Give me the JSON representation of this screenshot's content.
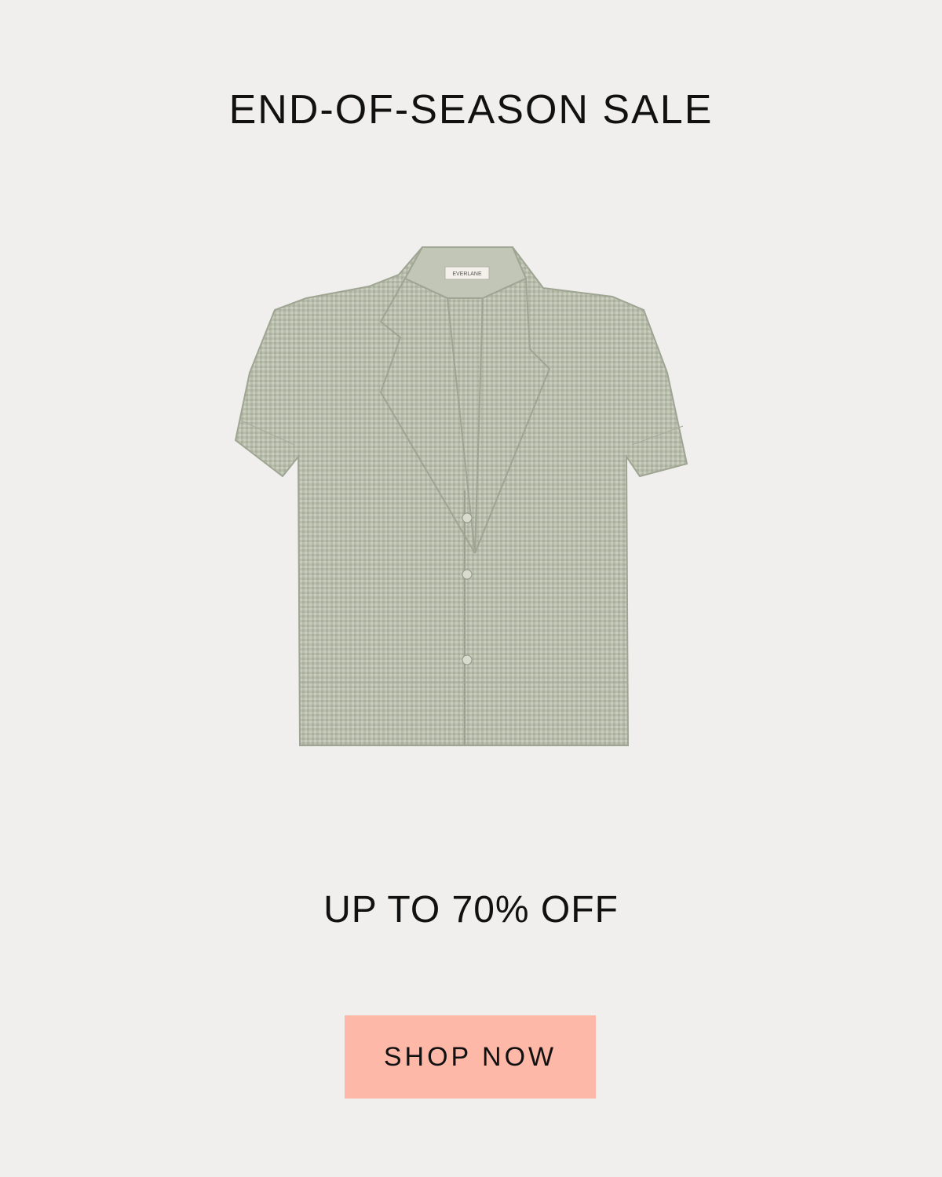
{
  "promo": {
    "headline": "END-OF-SEASON SALE",
    "subheadline": "UP TO 70% OFF",
    "cta_label": "SHOP NOW"
  },
  "product": {
    "label_text": "EVERLANE",
    "color": "#b6bcaa"
  },
  "colors": {
    "background": "#f0efee",
    "button": "#fdb8a8",
    "text": "#111111"
  }
}
